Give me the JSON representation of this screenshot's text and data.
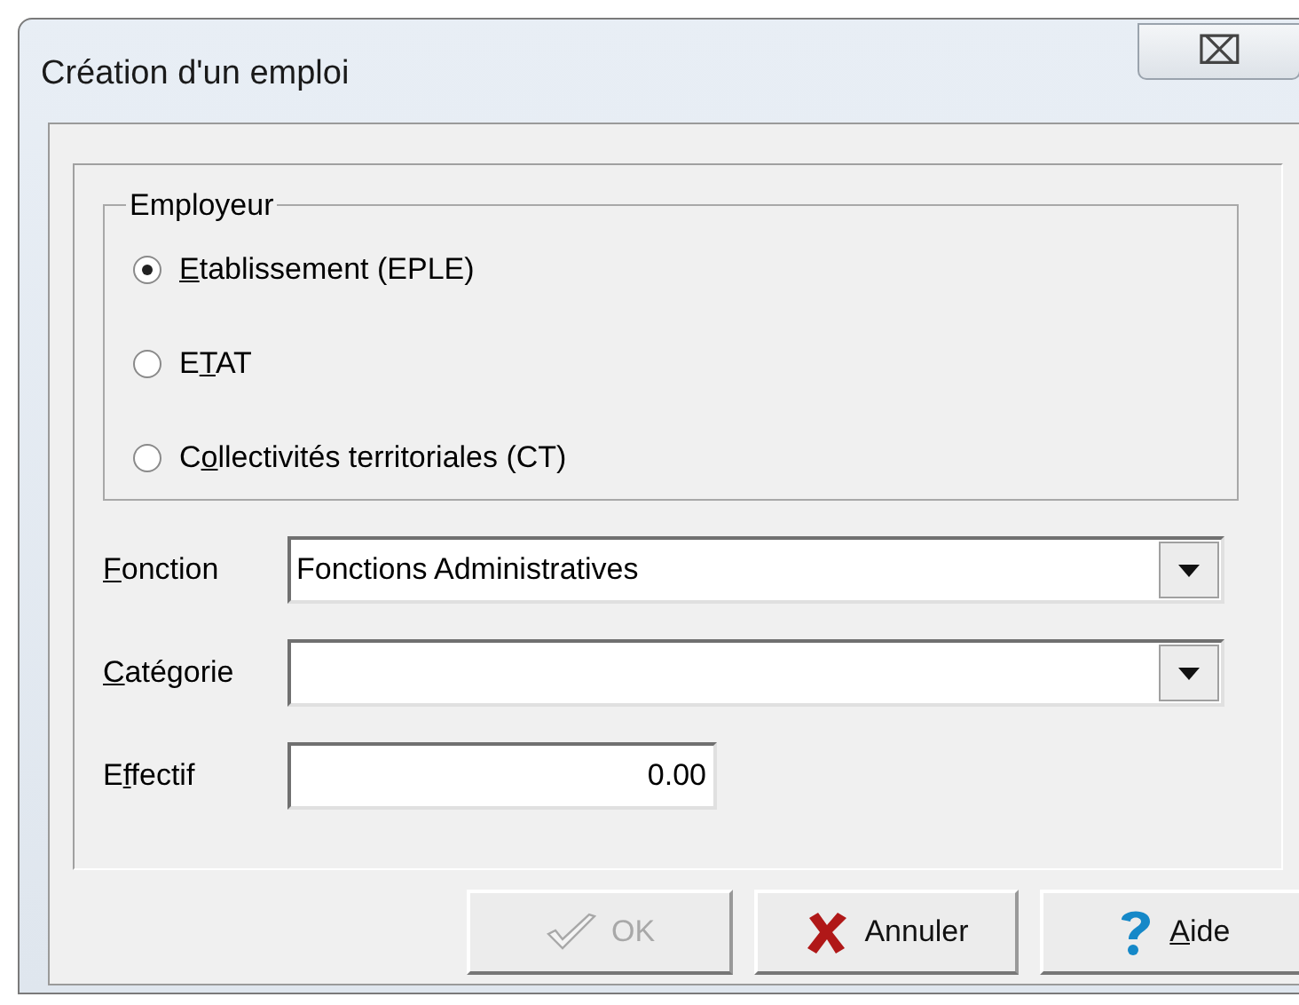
{
  "window": {
    "title": "Création d'un emploi",
    "close_icon": "⌧"
  },
  "employer": {
    "legend": "Employeur",
    "options": [
      {
        "key": "E",
        "post": "tablissement (EPLE)",
        "selected": true
      },
      {
        "pre": "E",
        "key": "T",
        "post": "AT",
        "selected": false
      },
      {
        "pre": "C",
        "key": "o",
        "post": "llectivités territoriales (CT)",
        "selected": false
      }
    ]
  },
  "fields": [
    {
      "kind": "dropdown",
      "label": {
        "key": "F",
        "post": "onction"
      },
      "value": "Fonctions Administratives"
    },
    {
      "kind": "dropdown",
      "label": {
        "key": "C",
        "post": "atégorie"
      }
    },
    {
      "kind": "number",
      "label": {
        "pre": "E",
        "key": "f",
        "post": "fectif"
      },
      "value": "0.00"
    }
  ],
  "buttons": [
    {
      "kind": "ok",
      "label": {
        "post": "OK"
      },
      "disabled": true
    },
    {
      "kind": "cancel",
      "label": {
        "post": "Annuler"
      },
      "disabled": false
    },
    {
      "kind": "help",
      "label": {
        "key": "A",
        "post": "ide"
      },
      "disabled": false
    }
  ]
}
